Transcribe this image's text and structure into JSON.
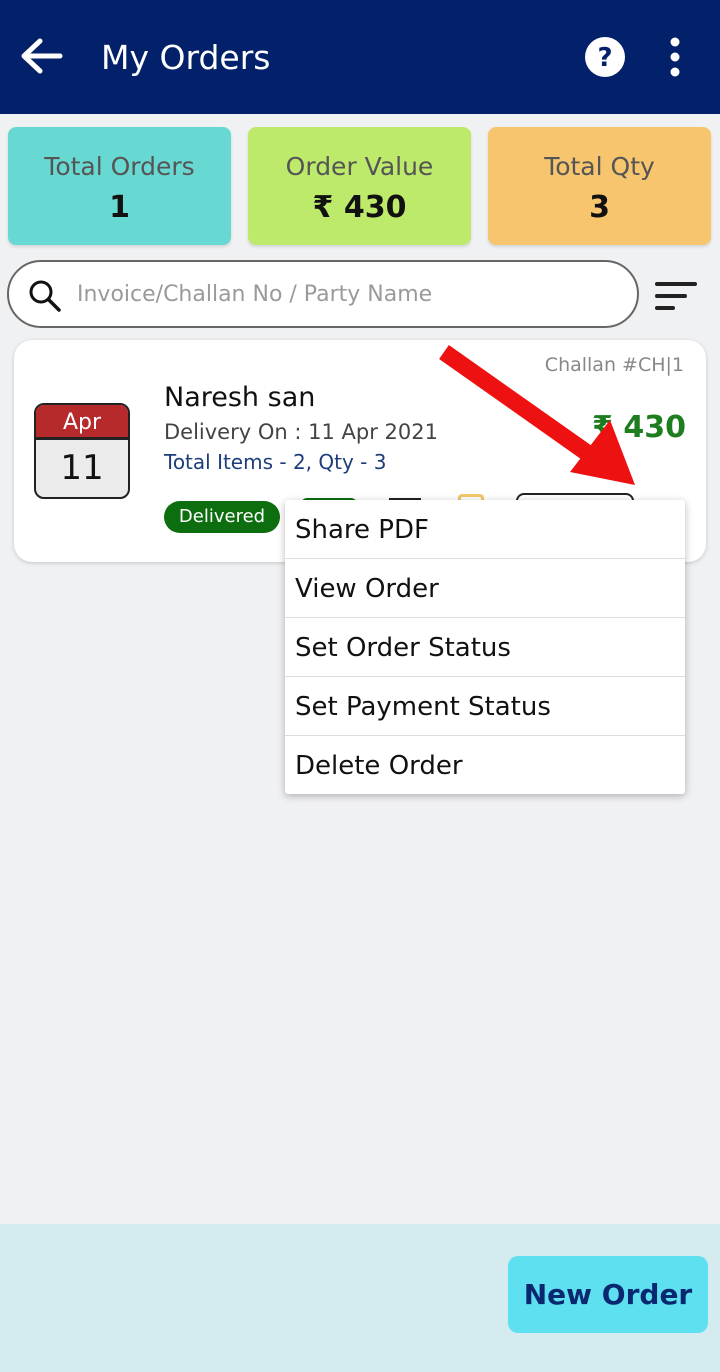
{
  "header": {
    "title": "My Orders",
    "background": "#03216a",
    "icons": [
      "back-arrow-icon",
      "help-icon",
      "more-vert-icon"
    ]
  },
  "stats": {
    "total_orders": {
      "label": "Total Orders",
      "value": "1"
    },
    "order_value": {
      "label": "Order Value",
      "value": "₹ 430"
    },
    "total_qty": {
      "label": "Total Qty",
      "value": "3"
    }
  },
  "search": {
    "placeholder": "Invoice/Challan No / Party Name",
    "value": ""
  },
  "order": {
    "challan": "Challan #CH|1",
    "month": "Apr",
    "day": "11",
    "party_name": "Naresh san",
    "delivery": "Delivery On : 11 Apr 2021",
    "items": "Total Items - 2, Qty - 3",
    "amount": "₹ 430",
    "status": "Delivered"
  },
  "menu": {
    "items": [
      "Share PDF",
      "View Order",
      "Set Order Status",
      "Set Payment Status",
      "Delete Order"
    ]
  },
  "footer": {
    "new_order_label": "New Order"
  },
  "colors": {
    "accent": "#03216a",
    "orders_card": "#68d8d2",
    "value_card": "#bdea6a",
    "qty_card": "#f6c56e",
    "amount_green": "#1d7d1f",
    "delivered_badge": "#0d6e0f",
    "annotation_arrow": "#ee1111"
  }
}
